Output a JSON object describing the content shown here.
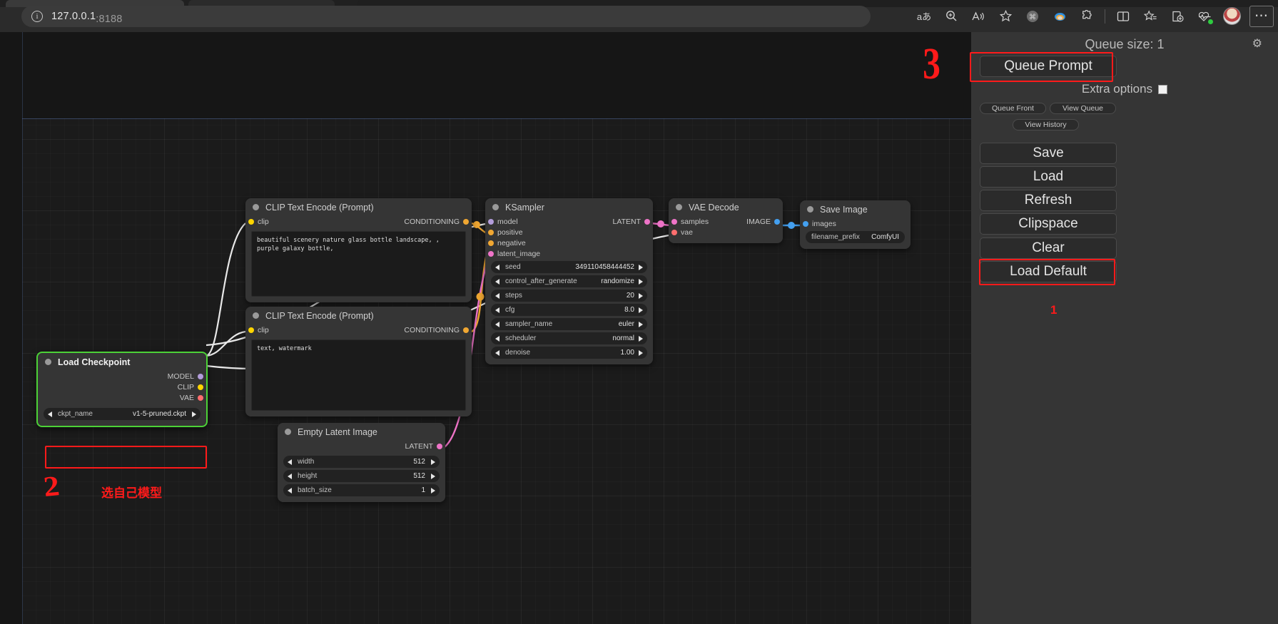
{
  "browser": {
    "url_host": "127.0.0.1",
    "url_port": ":8188",
    "info_icon": "info-icon",
    "toolbar_icons": [
      {
        "name": "translate-icon",
        "glyph": "aあ"
      },
      {
        "name": "zoom-icon",
        "glyph": "search-plus"
      },
      {
        "name": "read-aloud-icon",
        "glyph": "A"
      },
      {
        "name": "favorite-star-icon",
        "glyph": "star"
      },
      {
        "name": "extension-puzzle-icon",
        "glyph": "puzzle"
      },
      {
        "name": "split-screen-icon",
        "glyph": "split"
      },
      {
        "name": "collections-icon",
        "glyph": "collections"
      },
      {
        "name": "browser-essentials-icon",
        "glyph": "essentials"
      },
      {
        "name": "profile-avatar",
        "glyph": "avatar"
      },
      {
        "name": "settings-more-icon",
        "glyph": "..."
      }
    ]
  },
  "sidebar": {
    "queue_size_label": "Queue size: 1",
    "gear_icon": "gear-icon",
    "queue_prompt_label": "Queue Prompt",
    "extra_options_label": "Extra options",
    "queue_front_label": "Queue Front",
    "view_queue_label": "View Queue",
    "view_history_label": "View History",
    "save_label": "Save",
    "load_label": "Load",
    "refresh_label": "Refresh",
    "clipspace_label": "Clipspace",
    "clear_label": "Clear",
    "load_default_label": "Load Default"
  },
  "annotations": {
    "three": "3",
    "one": "1",
    "two": "2",
    "chinese_note": "选自己模型",
    "highlight_color": "#ff1a1a",
    "selected_node_border_color": "#4cd137"
  },
  "nodes": {
    "clip_positive": {
      "title": "CLIP Text Encode (Prompt)",
      "input_label": "clip",
      "output_label": "CONDITIONING",
      "text": "beautiful scenery nature glass bottle landscape, , purple galaxy bottle,"
    },
    "clip_negative": {
      "title": "CLIP Text Encode (Prompt)",
      "input_label": "clip",
      "output_label": "CONDITIONING",
      "text": "text, watermark"
    },
    "ksampler": {
      "title": "KSampler",
      "inputs": [
        "model",
        "positive",
        "negative",
        "latent_image"
      ],
      "output_label": "LATENT",
      "widgets": [
        {
          "name": "seed",
          "value": "349110458444452"
        },
        {
          "name": "control_after_generate",
          "value": "randomize"
        },
        {
          "name": "steps",
          "value": "20"
        },
        {
          "name": "cfg",
          "value": "8.0"
        },
        {
          "name": "sampler_name",
          "value": "euler"
        },
        {
          "name": "scheduler",
          "value": "normal"
        },
        {
          "name": "denoise",
          "value": "1.00"
        }
      ]
    },
    "vae_decode": {
      "title": "VAE Decode",
      "inputs": [
        "samples",
        "vae"
      ],
      "output_label": "IMAGE"
    },
    "save_image": {
      "title": "Save Image",
      "input_label": "images",
      "widget": {
        "name": "filename_prefix",
        "value": "ComfyUI"
      }
    },
    "load_checkpoint": {
      "title": "Load Checkpoint",
      "outputs": [
        "MODEL",
        "CLIP",
        "VAE"
      ],
      "widget": {
        "name": "ckpt_name",
        "value": "v1-5-pruned.ckpt"
      }
    },
    "empty_latent_image": {
      "title": "Empty Latent Image",
      "output_label": "LATENT",
      "widgets": [
        {
          "name": "width",
          "value": "512"
        },
        {
          "name": "height",
          "value": "512"
        },
        {
          "name": "batch_size",
          "value": "1"
        }
      ]
    }
  }
}
